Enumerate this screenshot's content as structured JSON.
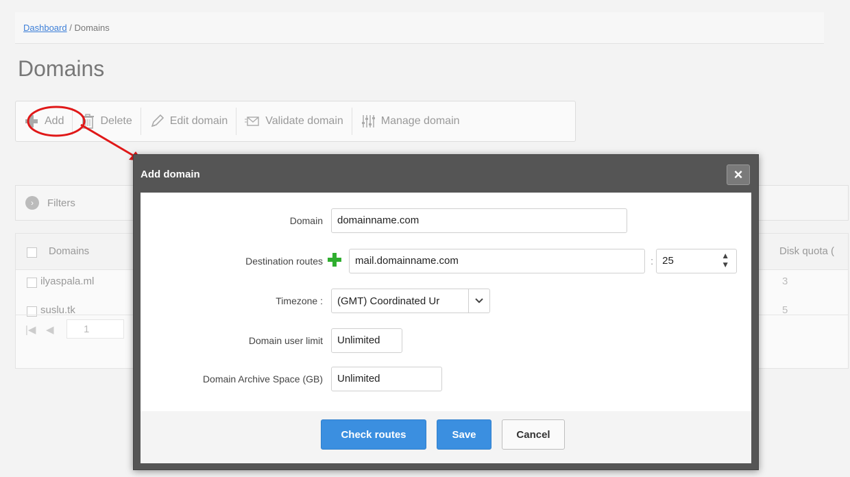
{
  "breadcrumb": {
    "link": "Dashboard",
    "separator": " / ",
    "current": "Domains"
  },
  "page_title": "Domains",
  "toolbar": {
    "add": "Add",
    "delete": "Delete",
    "edit": "Edit domain",
    "validate": "Validate domain",
    "manage": "Manage domain"
  },
  "filters_label": "Filters",
  "grid": {
    "col_domains": "Domains",
    "col_disk_quota": "Disk quota (",
    "rows": [
      {
        "domain": "ilyaspala.ml",
        "quota": "3"
      },
      {
        "domain": "suslu.tk",
        "quota": "5"
      }
    ],
    "pager_page": "1"
  },
  "dialog": {
    "title": "Add domain",
    "close": "×",
    "domain_label": "Domain",
    "domain_value": "domainname.com",
    "dest_label": "Destination routes",
    "dest_value": "mail.domainname.com",
    "port_sep": ":",
    "port_value": "25",
    "tz_label": "Timezone :",
    "tz_value": "(GMT) Coordinated Ur",
    "user_limit_label": "Domain user limit",
    "user_limit_value": "Unlimited",
    "archive_label": "Domain Archive Space (GB)",
    "archive_value": "Unlimited",
    "check_routes": "Check routes",
    "save": "Save",
    "cancel": "Cancel"
  },
  "colors": {
    "accent": "#3b8fe0",
    "plus_green": "#2fae2f",
    "annotation_red": "#e01818"
  }
}
